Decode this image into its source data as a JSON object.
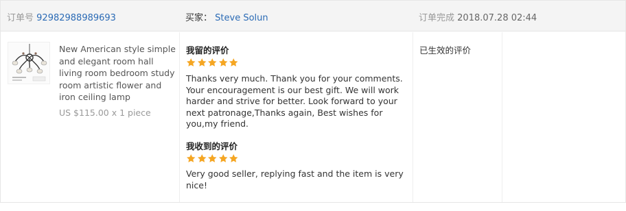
{
  "order": {
    "number_label": "订单号",
    "number": "92982988989693",
    "buyer_label": "买家：",
    "buyer_name": "Steve Solun",
    "completed_label": "订单完成",
    "completed_time": "2018.07.28 02:44"
  },
  "product": {
    "image_icon": "chandelier-product-thumbnail",
    "title": "New American style simple and elegant room hall living room bedroom study room artistic flower and iron ceiling lamp",
    "price": "US $115.00 x 1 piece"
  },
  "feedback_given": {
    "heading": "我留的评价",
    "stars": 5,
    "text": "Thanks very much. Thank you for your comments. Your encouragement is our best gift. We will work harder and strive for better. Look forward to your next patronage,Thanks again, Best wishes for you,my friend."
  },
  "feedback_received": {
    "heading": "我收到的评价",
    "stars": 5,
    "text": "Very good seller, replying fast and the item is very nice!"
  },
  "status": {
    "text": "已生效的评价"
  },
  "colors": {
    "star": "#f5a623",
    "link": "#2a6ab5",
    "header_bg": "#f4f4f4"
  }
}
